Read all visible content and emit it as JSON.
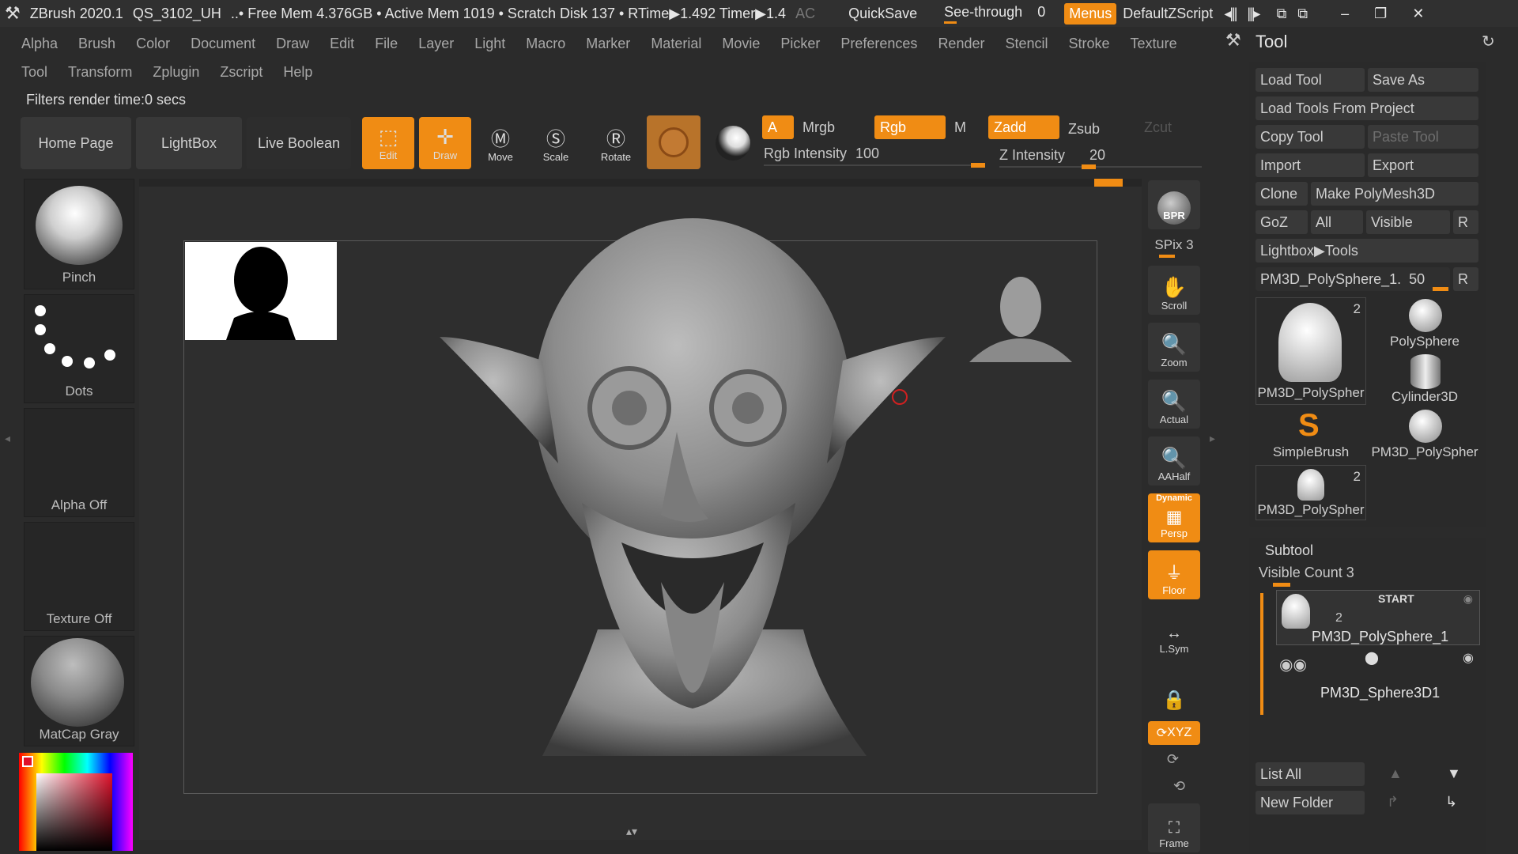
{
  "titlebar": {
    "app": "ZBrush 2020.1",
    "file": "QS_3102_UH",
    "stats": "..• Free Mem 4.376GB • Active Mem 1019 • Scratch Disk 137 • RTime▶1.492 Timer▶1.4",
    "ac": "AC",
    "quicksave": "QuickSave",
    "seethrough": "See-through",
    "seethrough_value": "0",
    "menus": "Menus",
    "script": "DefaultZScript"
  },
  "menu_row1": [
    "Alpha",
    "Brush",
    "Color",
    "Document",
    "Draw",
    "Edit",
    "File",
    "Layer",
    "Light",
    "Macro",
    "Marker",
    "Material",
    "Movie",
    "Picker",
    "Preferences",
    "Render",
    "Stencil",
    "Stroke",
    "Texture"
  ],
  "menu_row2": [
    "Tool",
    "Transform",
    "Zplugin",
    "Zscript",
    "Help"
  ],
  "status": "Filters render time:0 secs",
  "shelf": {
    "home": "Home Page",
    "lightbox": "LightBox",
    "live_boolean": "Live Boolean"
  },
  "tools": {
    "edit": "Edit",
    "draw": "Draw",
    "move": "Move",
    "scale": "Scale",
    "rotate": "Rotate"
  },
  "chips": {
    "a": "A",
    "mrgb": "Mrgb",
    "rgb": "Rgb",
    "m": "M",
    "zadd": "Zadd",
    "zsub": "Zsub",
    "zcut": "Zcut"
  },
  "sliders": {
    "rgb_intensity_label": "Rgb Intensity",
    "rgb_intensity": 100,
    "z_intensity_label": "Z Intensity",
    "z_intensity": 20
  },
  "left_panel": {
    "brush": "Pinch",
    "stroke": "Dots",
    "alpha": "Alpha Off",
    "texture": "Texture Off",
    "material": "MatCap Gray"
  },
  "canvas_side": {
    "bpr": "BPR",
    "spix": "SPix 3",
    "scroll": "Scroll",
    "zoom": "Zoom",
    "actual": "Actual",
    "aahalf": "AAHalf",
    "dynamic": "Dynamic",
    "persp": "Persp",
    "floor": "Floor",
    "lsym": "L.Sym",
    "xyz": "XYZ",
    "frame": "Frame"
  },
  "tool_panel": {
    "title": "Tool",
    "load_tool": "Load Tool",
    "save_as": "Save As",
    "load_from_project": "Load Tools From Project",
    "copy_tool": "Copy Tool",
    "paste_tool": "Paste Tool",
    "import": "Import",
    "export": "Export",
    "clone": "Clone",
    "make_polymesh": "Make PolyMesh3D",
    "goz": "GoZ",
    "all": "All",
    "visible": "Visible",
    "r": "R",
    "lightbox_tools": "Lightbox▶Tools",
    "current_tool": "PM3D_PolySphere_1.",
    "current_tool_value": "50",
    "thumbs": [
      {
        "label": "PM3D_PolySpher",
        "count": "2"
      },
      {
        "label": "PolySphere",
        "count": ""
      },
      {
        "label": "Cylinder3D",
        "count": ""
      },
      {
        "label": "SimpleBrush",
        "count": ""
      },
      {
        "label": "PM3D_PolySpher",
        "count": ""
      },
      {
        "label": "PM3D_PolySpher",
        "count": "2"
      }
    ]
  },
  "subtool": {
    "title": "Subtool",
    "visible_count": "Visible Count 3",
    "start": "START",
    "item1_count": "2",
    "item1": "PM3D_PolySphere_1",
    "item2": "PM3D_Sphere3D1",
    "list_all": "List All",
    "new_folder": "New Folder"
  },
  "colors": {
    "accent": "#f08c14",
    "bg": "#2b2b2b",
    "panel": "#393939"
  }
}
